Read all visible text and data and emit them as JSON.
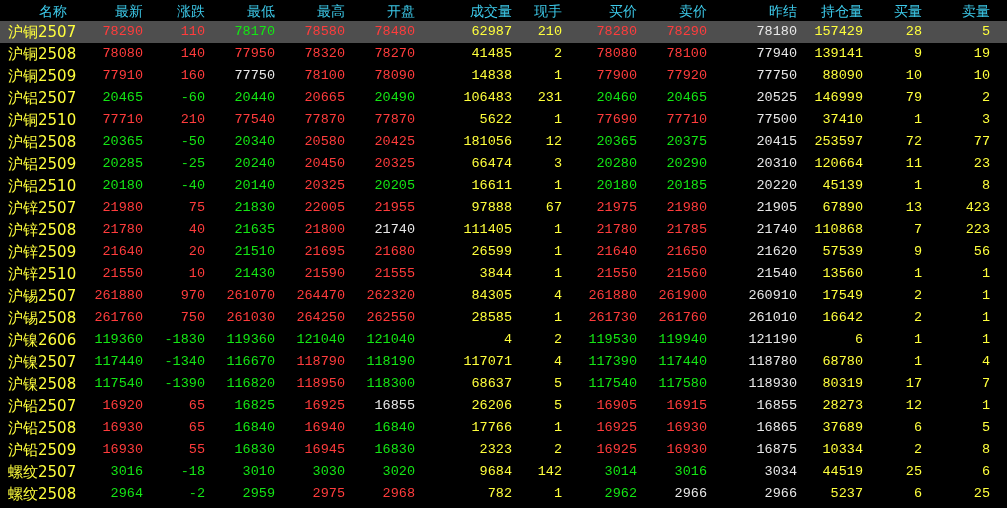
{
  "columns": [
    {
      "label": "名称",
      "kind": "name"
    },
    {
      "label": "最新",
      "kind": "price"
    },
    {
      "label": "涨跌",
      "kind": "change"
    },
    {
      "label": "最低",
      "kind": "price"
    },
    {
      "label": "最高",
      "kind": "price"
    },
    {
      "label": "开盘",
      "kind": "price"
    },
    {
      "label": "成交量",
      "kind": "volume"
    },
    {
      "label": "现手",
      "kind": "volume"
    },
    {
      "label": "买价",
      "kind": "price"
    },
    {
      "label": "卖价",
      "kind": "price"
    },
    {
      "label": "昨结",
      "kind": "reference"
    },
    {
      "label": "持仓量",
      "kind": "volume"
    },
    {
      "label": "买量",
      "kind": "volume"
    },
    {
      "label": "卖量",
      "kind": "volume"
    }
  ],
  "rows": [
    {
      "selected": true,
      "cells": [
        "沪铜2507",
        "78290",
        "110",
        "78170",
        "78580",
        "78480",
        "62987",
        "210",
        "78280",
        "78290",
        "78180",
        "157429",
        "28",
        "5"
      ]
    },
    {
      "selected": false,
      "cells": [
        "沪铜2508",
        "78080",
        "140",
        "77950",
        "78320",
        "78270",
        "41485",
        "2",
        "78080",
        "78100",
        "77940",
        "139141",
        "9",
        "19"
      ]
    },
    {
      "selected": false,
      "cells": [
        "沪铜2509",
        "77910",
        "160",
        "77750",
        "78100",
        "78090",
        "14838",
        "1",
        "77900",
        "77920",
        "77750",
        "88090",
        "10",
        "10"
      ]
    },
    {
      "selected": false,
      "cells": [
        "沪铝2507",
        "20465",
        "-60",
        "20440",
        "20665",
        "20490",
        "106483",
        "231",
        "20460",
        "20465",
        "20525",
        "146999",
        "79",
        "2"
      ]
    },
    {
      "selected": false,
      "cells": [
        "沪铜2510",
        "77710",
        "210",
        "77540",
        "77870",
        "77870",
        "5622",
        "1",
        "77690",
        "77710",
        "77500",
        "37410",
        "1",
        "3"
      ]
    },
    {
      "selected": false,
      "cells": [
        "沪铝2508",
        "20365",
        "-50",
        "20340",
        "20580",
        "20425",
        "181056",
        "12",
        "20365",
        "20375",
        "20415",
        "253597",
        "72",
        "77"
      ]
    },
    {
      "selected": false,
      "cells": [
        "沪铝2509",
        "20285",
        "-25",
        "20240",
        "20450",
        "20325",
        "66474",
        "3",
        "20280",
        "20290",
        "20310",
        "120664",
        "11",
        "23"
      ]
    },
    {
      "selected": false,
      "cells": [
        "沪铝2510",
        "20180",
        "-40",
        "20140",
        "20325",
        "20205",
        "16611",
        "1",
        "20180",
        "20185",
        "20220",
        "45139",
        "1",
        "8"
      ]
    },
    {
      "selected": false,
      "cells": [
        "沪锌2507",
        "21980",
        "75",
        "21830",
        "22005",
        "21955",
        "97888",
        "67",
        "21975",
        "21980",
        "21905",
        "67890",
        "13",
        "423"
      ]
    },
    {
      "selected": false,
      "cells": [
        "沪锌2508",
        "21780",
        "40",
        "21635",
        "21800",
        "21740",
        "111405",
        "1",
        "21780",
        "21785",
        "21740",
        "110868",
        "7",
        "223"
      ]
    },
    {
      "selected": false,
      "cells": [
        "沪锌2509",
        "21640",
        "20",
        "21510",
        "21695",
        "21680",
        "26599",
        "1",
        "21640",
        "21650",
        "21620",
        "57539",
        "9",
        "56"
      ]
    },
    {
      "selected": false,
      "cells": [
        "沪锌2510",
        "21550",
        "10",
        "21430",
        "21590",
        "21555",
        "3844",
        "1",
        "21550",
        "21560",
        "21540",
        "13560",
        "1",
        "1"
      ]
    },
    {
      "selected": false,
      "cells": [
        "沪锡2507",
        "261880",
        "970",
        "261070",
        "264470",
        "262320",
        "84305",
        "4",
        "261880",
        "261900",
        "260910",
        "17549",
        "2",
        "1"
      ]
    },
    {
      "selected": false,
      "cells": [
        "沪锡2508",
        "261760",
        "750",
        "261030",
        "264250",
        "262550",
        "28585",
        "1",
        "261730",
        "261760",
        "261010",
        "16642",
        "2",
        "1"
      ]
    },
    {
      "selected": false,
      "cells": [
        "沪镍2606",
        "119360",
        "-1830",
        "119360",
        "121040",
        "121040",
        "4",
        "2",
        "119530",
        "119940",
        "121190",
        "6",
        "1",
        "1"
      ]
    },
    {
      "selected": false,
      "cells": [
        "沪镍2507",
        "117440",
        "-1340",
        "116670",
        "118790",
        "118190",
        "117071",
        "4",
        "117390",
        "117440",
        "118780",
        "68780",
        "1",
        "4"
      ]
    },
    {
      "selected": false,
      "cells": [
        "沪镍2508",
        "117540",
        "-1390",
        "116820",
        "118950",
        "118300",
        "68637",
        "5",
        "117540",
        "117580",
        "118930",
        "80319",
        "17",
        "7"
      ]
    },
    {
      "selected": false,
      "cells": [
        "沪铅2507",
        "16920",
        "65",
        "16825",
        "16925",
        "16855",
        "26206",
        "5",
        "16905",
        "16915",
        "16855",
        "28273",
        "12",
        "1"
      ]
    },
    {
      "selected": false,
      "cells": [
        "沪铅2508",
        "16930",
        "65",
        "16840",
        "16940",
        "16840",
        "17766",
        "1",
        "16925",
        "16930",
        "16865",
        "37689",
        "6",
        "5"
      ]
    },
    {
      "selected": false,
      "cells": [
        "沪铅2509",
        "16930",
        "55",
        "16830",
        "16945",
        "16830",
        "2323",
        "2",
        "16925",
        "16930",
        "16875",
        "10334",
        "2",
        "8"
      ]
    },
    {
      "selected": false,
      "cells": [
        "螺纹2507",
        "3016",
        "-18",
        "3010",
        "3030",
        "3020",
        "9684",
        "142",
        "3014",
        "3016",
        "3034",
        "44519",
        "25",
        "6"
      ]
    },
    {
      "selected": false,
      "cells": [
        "螺纹2508",
        "2964",
        "-2",
        "2959",
        "2975",
        "2968",
        "782",
        "1",
        "2962",
        "2966",
        "2966",
        "5237",
        "6",
        "25"
      ]
    }
  ]
}
